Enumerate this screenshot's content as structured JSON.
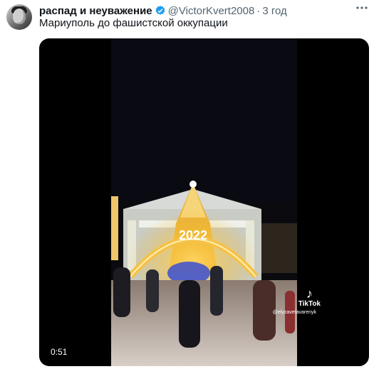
{
  "tweet": {
    "display_name": "распад и неуважение",
    "handle": "@VictorKvert2008",
    "separator": "·",
    "time": "3 год",
    "text": "Мариуполь до фашистской оккупации"
  },
  "video": {
    "duration": "0:51",
    "banner_year": "2022",
    "watermark_brand": "TikTok",
    "watermark_user": "@elyzavetavarenyk"
  },
  "icons": {
    "verified": "verified-badge-icon",
    "more": "more-options-icon",
    "tiktok": "tiktok-logo-icon"
  },
  "colors": {
    "verified_blue": "#1d9bf0",
    "secondary_text": "#536471",
    "primary_text": "#0f1419"
  }
}
